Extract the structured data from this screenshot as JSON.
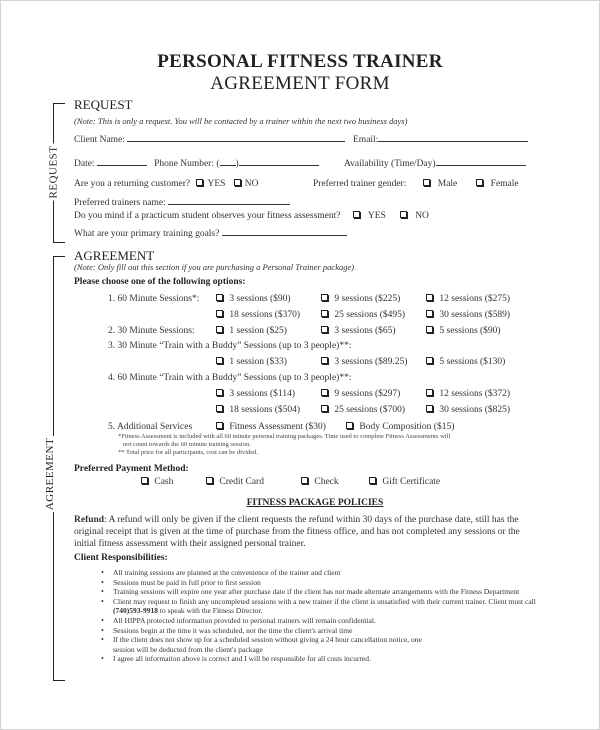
{
  "title": {
    "line1": "PERSONAL FITNESS TRAINER",
    "line2": "AGREEMENT FORM"
  },
  "request": {
    "heading": "REQUEST",
    "side_label": "REQUEST",
    "note": "(Note: This is only a request. You will be contacted by a trainer within the next two business days)",
    "client_name_label": "Client Name:",
    "email_label": "Email:",
    "date_label": "Date:",
    "phone_label": "Phone Number: (",
    "phone_paren_close": ")",
    "availability_label": "Availability (Time/Day)",
    "returning_label": "Are you a returning customer?",
    "yes": "YES",
    "no": "NO",
    "gender_label": "Preferred trainer gender:",
    "male": "Male",
    "female": "Female",
    "trainer_name_label": "Preferred trainers name:",
    "practicum_label": "Do you mind if a practicum student observes your fitness assessment?",
    "goals_label": "What are your primary training goals?"
  },
  "agreement": {
    "heading": "AGREEMENT",
    "side_label": "AGREEMENT",
    "note": "(Note: Only fill out this section if you are purchasing a Personal Trainer package)",
    "choose_label": "Please choose one of the following options:",
    "options": [
      {
        "label": "1. 60 Minute Sessions*:",
        "rows": [
          [
            "3 sessions ($90)",
            "9 sessions ($225)",
            "12 sessions ($275)"
          ],
          [
            "18 sessions ($370)",
            "25 sessions ($495)",
            "30 sessions ($589)"
          ]
        ]
      },
      {
        "label": "2. 30 Minute Sessions:",
        "rows": [
          [
            "1 session ($25)",
            "3 sessions ($65)",
            "5 sessions ($90)"
          ]
        ]
      },
      {
        "label": "3. 30 Minute “Train with a Buddy” Sessions (up to 3 people)**:",
        "rows": [
          [
            "1 session ($33)",
            "3 sessions ($89.25)",
            "5 sessions ($130)"
          ]
        ]
      },
      {
        "label": "4. 60 Minute “Train with a Buddy” Sessions (up to 3 people)**:",
        "rows": [
          [
            "3 sessions ($114)",
            "9 sessions ($297)",
            "12 sessions ($372)"
          ],
          [
            "18 sessions ($504)",
            "25 sessions ($700)",
            "30 sessions ($825)"
          ]
        ]
      }
    ],
    "additional": {
      "label": "5. Additional Services",
      "items": [
        "Fitness Assessment ($30)",
        "Body Composition ($15)"
      ]
    },
    "footnote1a": "*Fitness Assessment is included with all 60 minute personal training packages. Time used to complete Fitness Assessments will",
    "footnote1b": "not count towards the 60 minute training session.",
    "footnote2": "** Total price for all participants, cost can be divided.",
    "payment_label": "Preferred Payment Method:",
    "payment_options": [
      "Cash",
      "Credit Card",
      "Check",
      "Gift Certificate"
    ]
  },
  "policies": {
    "heading": "FITNESS PACKAGE POLICIES",
    "refund_label": "Refund",
    "refund_text": ": A refund will only be given if the client requests the refund within 30 days of the purchase date, still has the original receipt that is given at the time of purchase from the fitness office, and has not completed any sessions or the initial fitness assessment with their assigned personal trainer.",
    "responsibilities_label": "Client Responsibilities:",
    "responsibilities": [
      "All training sessions are planned at the convenience of the trainer and client",
      "Sessions must be paid in full prior to first session",
      "Training sessions will expire one year after purchase date if the client has not made alternate arrangements with the Fitness Department",
      "Client may request to finish any uncompleted sessions with a new trainer if the client is unsatisfied with their current trainer. Client must call ",
      "All HIPPA protected information provided to personal trainers will remain confidential.",
      "Sessions begin at the time it was scheduled, not the time the client's arrival time",
      "If the client does not show up for a scheduled session without giving a 24 hour cancellation notice, one session will be deducted from the client's package",
      "I agree all information above is correct and I will be responsible for all costs incurred."
    ],
    "phone_number": "(740)593-9918",
    "phone_suffix": " to speak with the Fitness Director."
  }
}
